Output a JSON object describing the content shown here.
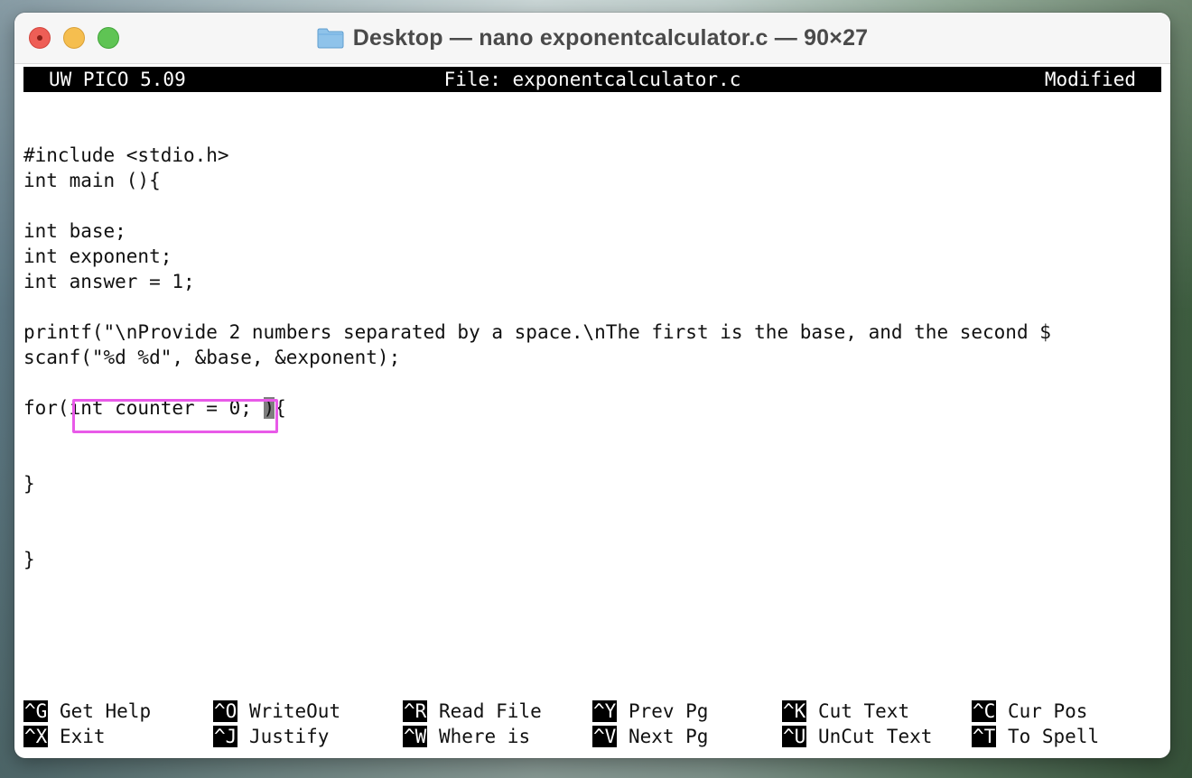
{
  "window": {
    "title": "Desktop — nano exponentcalculator.c — 90×27",
    "folder_icon": "folder-icon"
  },
  "editor": {
    "app_version": "UW PICO 5.09",
    "file_label": "File: exponentcalculator.c",
    "status": "Modified"
  },
  "code_lines": [
    "#include <stdio.h>",
    "int main (){",
    "",
    "int base;",
    "int exponent;",
    "int answer = 1;",
    "",
    "printf(\"\\nProvide 2 numbers separated by a space.\\nThe first is the base, and the second $",
    "scanf(\"%d %d\", &base, &exponent);",
    "",
    {
      "before_cursor": "for(int counter = 0; ",
      "cursor_char": ")",
      "after_cursor": "{"
    },
    "",
    "",
    "}",
    "",
    "",
    "}"
  ],
  "shortcuts": [
    {
      "key": "^G",
      "label": "Get Help"
    },
    {
      "key": "^O",
      "label": "WriteOut"
    },
    {
      "key": "^R",
      "label": "Read File"
    },
    {
      "key": "^Y",
      "label": "Prev Pg"
    },
    {
      "key": "^K",
      "label": "Cut Text"
    },
    {
      "key": "^C",
      "label": "Cur Pos"
    },
    {
      "key": "^X",
      "label": "Exit"
    },
    {
      "key": "^J",
      "label": "Justify"
    },
    {
      "key": "^W",
      "label": "Where is"
    },
    {
      "key": "^V",
      "label": "Next Pg"
    },
    {
      "key": "^U",
      "label": "UnCut Text"
    },
    {
      "key": "^T",
      "label": "To Spell"
    }
  ],
  "colors": {
    "annotation_highlight": "#e85ae8",
    "cursor": "#7d7d7d"
  }
}
